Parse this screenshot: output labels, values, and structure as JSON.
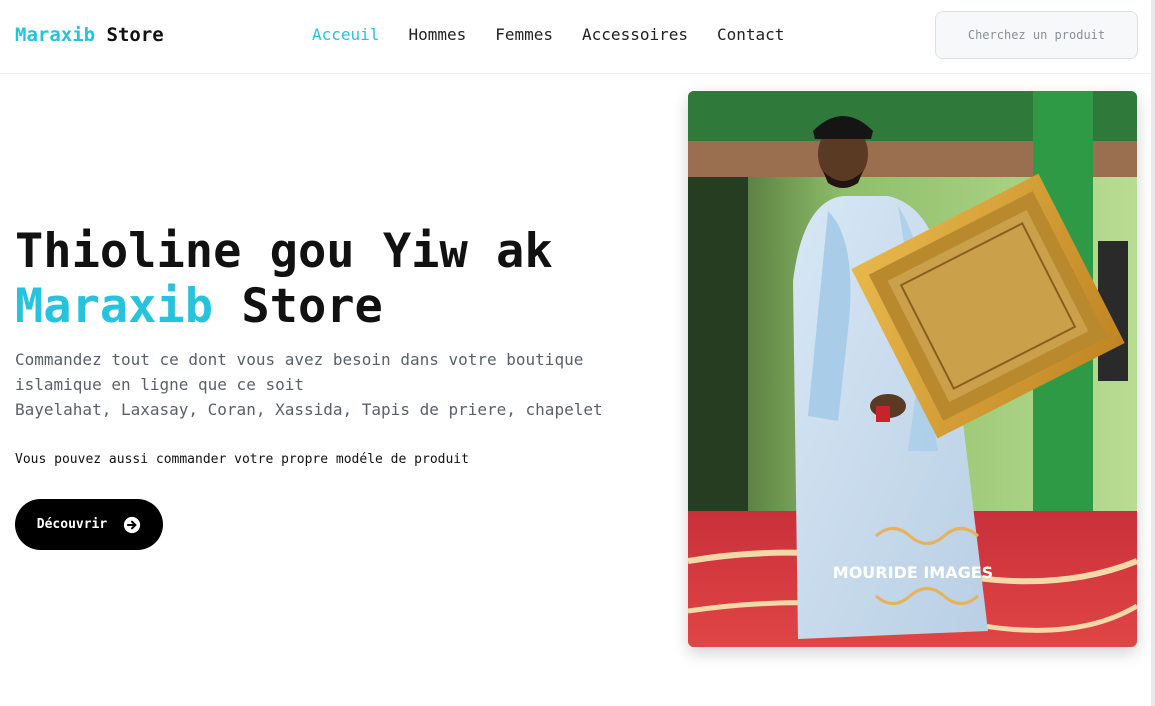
{
  "brand": {
    "accent": "Maraxib",
    "rest": "Store"
  },
  "nav": {
    "items": [
      {
        "label": "Acceuil",
        "active": true
      },
      {
        "label": "Hommes"
      },
      {
        "label": "Femmes"
      },
      {
        "label": "Accessoires"
      },
      {
        "label": "Contact"
      }
    ]
  },
  "search": {
    "placeholder": "Cherchez un produit"
  },
  "hero": {
    "title_line1": "Thioline gou Yiw ak",
    "title_accent": "Maraxib",
    "title_rest": "Store",
    "description_line1": "Commandez tout ce dont vous avez besoin dans votre boutique",
    "description_line2": "islamique en ligne que ce soit",
    "description_line3": "Bayelahat, Laxasay, Coran, Xassida, Tapis de priere, chapelet",
    "note": "Vous pouvez aussi commander votre propre modéle de produit",
    "cta_label": "Découvrir",
    "cta_icon": "arrow-right-circle-icon"
  },
  "image": {
    "watermark": "MOURIDE IMAGES",
    "alt": "Homme en boubou blanc tenant un cadre doré"
  },
  "colors": {
    "accent": "#27c3dc",
    "text": "#111111",
    "muted": "#5b6068",
    "button": "#000000"
  }
}
